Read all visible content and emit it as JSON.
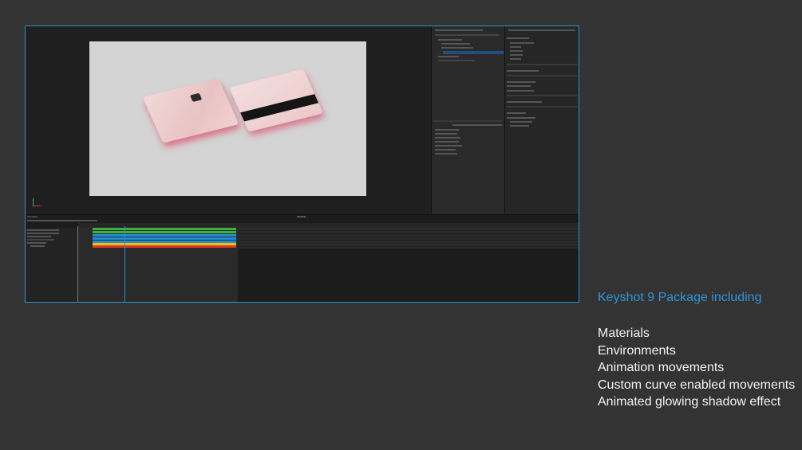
{
  "window": {
    "timeline_title": "Timeline",
    "animation_label": "Animation"
  },
  "caption": {
    "title": "Keyshot 9 Package including",
    "features": [
      "Materials",
      "Environments",
      "Animation movements",
      "Custom curve enabled movements",
      "Animated glowing shadow effect"
    ]
  },
  "colors": {
    "accent": "#2e8fd0",
    "background": "#333333",
    "track_green": "#3cb043",
    "track_blue": "#1f8fd6",
    "track_yellow": "#f2c200",
    "track_red": "#e0392b"
  }
}
